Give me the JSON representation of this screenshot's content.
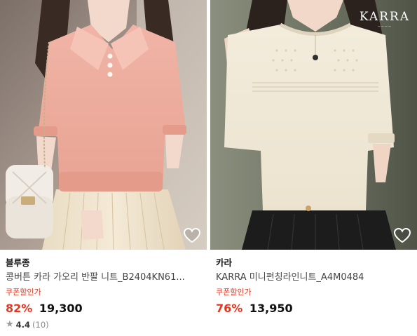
{
  "colors": {
    "discount_red": "#e8341c",
    "coupon_red": "#e8341c",
    "text_dark": "#111111",
    "text_gray": "#444444",
    "star_gray": "#9a9a9a"
  },
  "products": [
    {
      "image_alt": "pink collared knit top",
      "brand": "블루종",
      "title": "콩버튼 카라 가오리 반팔 니트_B2404KN61...",
      "coupon_label": "쿠폰할인가",
      "discount": "82%",
      "price": "19,300",
      "rating": {
        "icon": "star-icon",
        "score": "4.4",
        "count": "(10)"
      },
      "wishlist_icon": "heart-icon"
    },
    {
      "image_alt": "ivory punching-line knit top",
      "image_logo": "KARRA",
      "brand": "카라",
      "title": "KARRA 미니펀칭라인니트_A4M0484",
      "coupon_label": "쿠폰할인가",
      "discount": "76%",
      "price": "13,950",
      "wishlist_icon": "heart-icon"
    }
  ]
}
